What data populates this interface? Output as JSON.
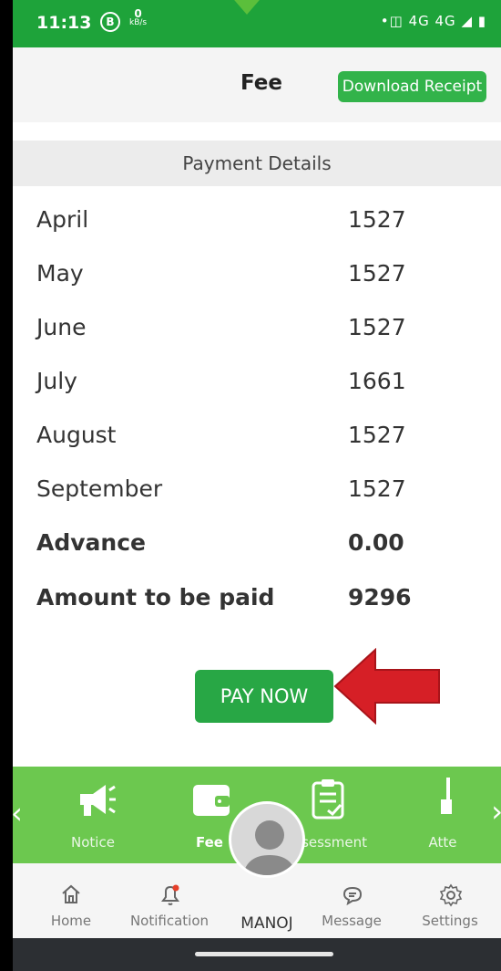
{
  "status_bar": {
    "time": "11:13",
    "b_icon": "B",
    "speed_value": "0",
    "speed_unit": "kB/s",
    "right_icons": "•◫ 4G 4G ◢ ▮"
  },
  "header": {
    "title": "Fee",
    "download_label": "Download Receipt"
  },
  "payment": {
    "section_title": "Payment Details",
    "rows": [
      {
        "label": "April",
        "value": "1527"
      },
      {
        "label": "May",
        "value": "1527"
      },
      {
        "label": "June",
        "value": "1527"
      },
      {
        "label": "July",
        "value": "1661"
      },
      {
        "label": "August",
        "value": "1527"
      },
      {
        "label": "September",
        "value": "1527"
      }
    ],
    "advance_label": "Advance",
    "advance_value": "0.00",
    "total_label": "Amount to be paid",
    "total_value": "9296"
  },
  "pay_now_label": "PAY NOW",
  "modules": {
    "items": [
      {
        "label": "Notice",
        "icon": "megaphone-icon"
      },
      {
        "label": "Fee",
        "icon": "wallet-icon"
      },
      {
        "label": "Assessment",
        "icon": "clipboard-check-icon"
      },
      {
        "label": "Atte",
        "icon": "attendance-icon"
      }
    ]
  },
  "bottom_nav": {
    "home": "Home",
    "notification": "Notification",
    "profile": "MANOJ",
    "message": "Message",
    "settings": "Settings"
  },
  "colors": {
    "status_green": "#1ea33a",
    "button_green": "#32b34a",
    "strip_green": "#6cc84f",
    "arrow_red": "#d61f26"
  }
}
